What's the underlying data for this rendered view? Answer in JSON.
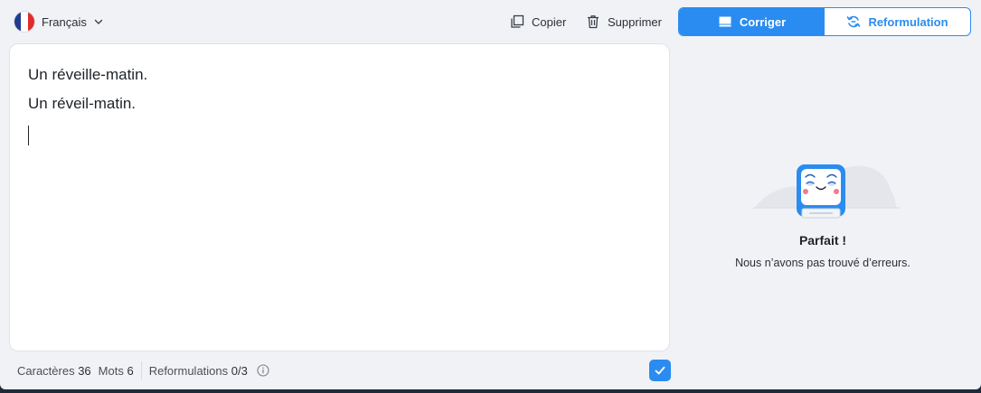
{
  "language": {
    "label": "Français",
    "icon": "french-flag-icon"
  },
  "toolbar": {
    "copy_label": "Copier",
    "delete_label": "Supprimer"
  },
  "modes": [
    {
      "label": "Corriger",
      "icon": "monitor-icon",
      "active": true
    },
    {
      "label": "Reformulation",
      "icon": "refresh-icon",
      "active": false
    }
  ],
  "editor": {
    "lines": [
      "Un réveille-matin.",
      "Un réveil-matin."
    ]
  },
  "footer": {
    "chars_label": "Caractères",
    "chars_value": "36",
    "words_label": "Mots",
    "words_value": "6",
    "reform_label": "Reformulations",
    "reform_value": "0/3"
  },
  "result": {
    "title": "Parfait !",
    "subtitle": "Nous n’avons pas trouvé d’erreurs."
  },
  "colors": {
    "accent": "#2a8cf0",
    "panel_bg": "#f1f2f6",
    "editor_bg": "#ffffff"
  }
}
